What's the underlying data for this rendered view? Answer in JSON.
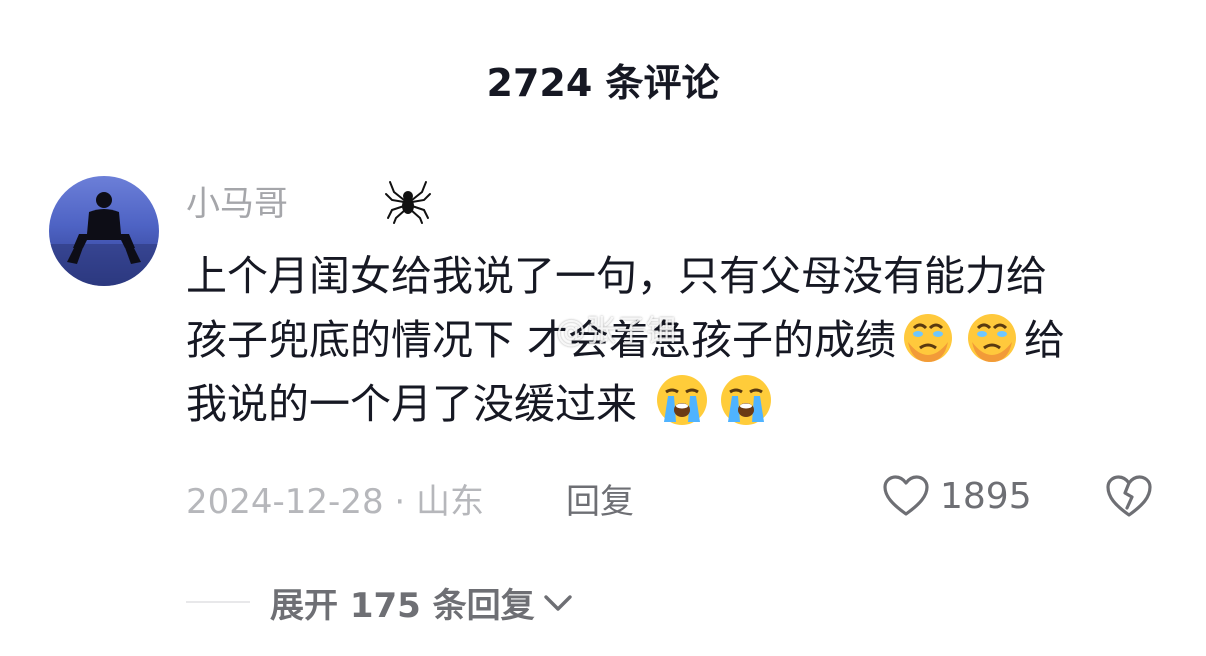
{
  "header": {
    "title": "2724 条评论"
  },
  "comment": {
    "username": "小马哥",
    "username_icon": "spider-icon",
    "text_lines": [
      "上个月闺女给我说了一句，只有父母没有能力给",
      "孩子兜底的情况下 才会着急孩子的成绩",
      "给",
      "我说的一个月了没缓过来 "
    ],
    "emoji_1": "crying-face-emoji",
    "emoji_2": "loudly-crying-emoji",
    "date_location": "2024-12-28 · 山东",
    "reply_label": "回复",
    "like_count": "1895",
    "like_icon": "heart-outline-icon",
    "dislike_icon": "broken-heart-icon"
  },
  "expand": {
    "label": "展开 175 条回复"
  },
  "watermark": {
    "text": "@张子钿"
  },
  "colors": {
    "primary_text": "#161823",
    "secondary_text": "#6e6f74",
    "muted_text": "#a5a6aa",
    "background": "#ffffff"
  }
}
